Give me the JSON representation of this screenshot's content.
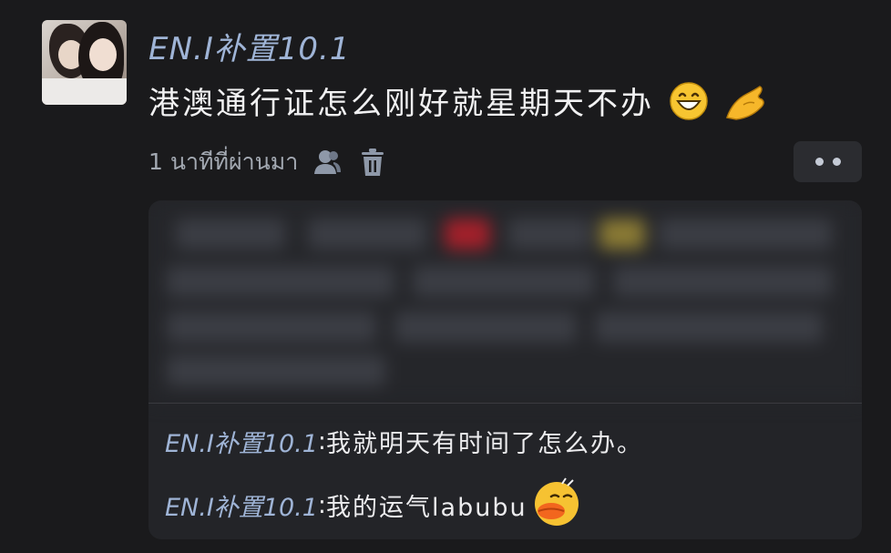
{
  "post": {
    "username": "EN.I补置10.1",
    "message": "港澳通行证怎么刚好就星期天不办",
    "emojis": [
      "grinning-face-emoji",
      "pinched-hand-emoji"
    ],
    "time_ago": "1 นาทีที่ผ่านมา",
    "icons": {
      "author": "person-icon",
      "delete": "trash-icon",
      "more": "more-dots-icon"
    }
  },
  "comments": [
    {
      "author": "EN.I补置10.1",
      "separator": ":",
      "text": "我就明天有时间了怎么办。"
    },
    {
      "author": "EN.I补置10.1",
      "separator": ":",
      "text": "我的运气labubu",
      "emoji": "duck-face-emoji"
    }
  ],
  "colors": {
    "background": "#1a1a1c",
    "card": "#232428",
    "username": "#9fb4d6",
    "text": "#f1f1f2",
    "meta": "#a3a9b2"
  }
}
